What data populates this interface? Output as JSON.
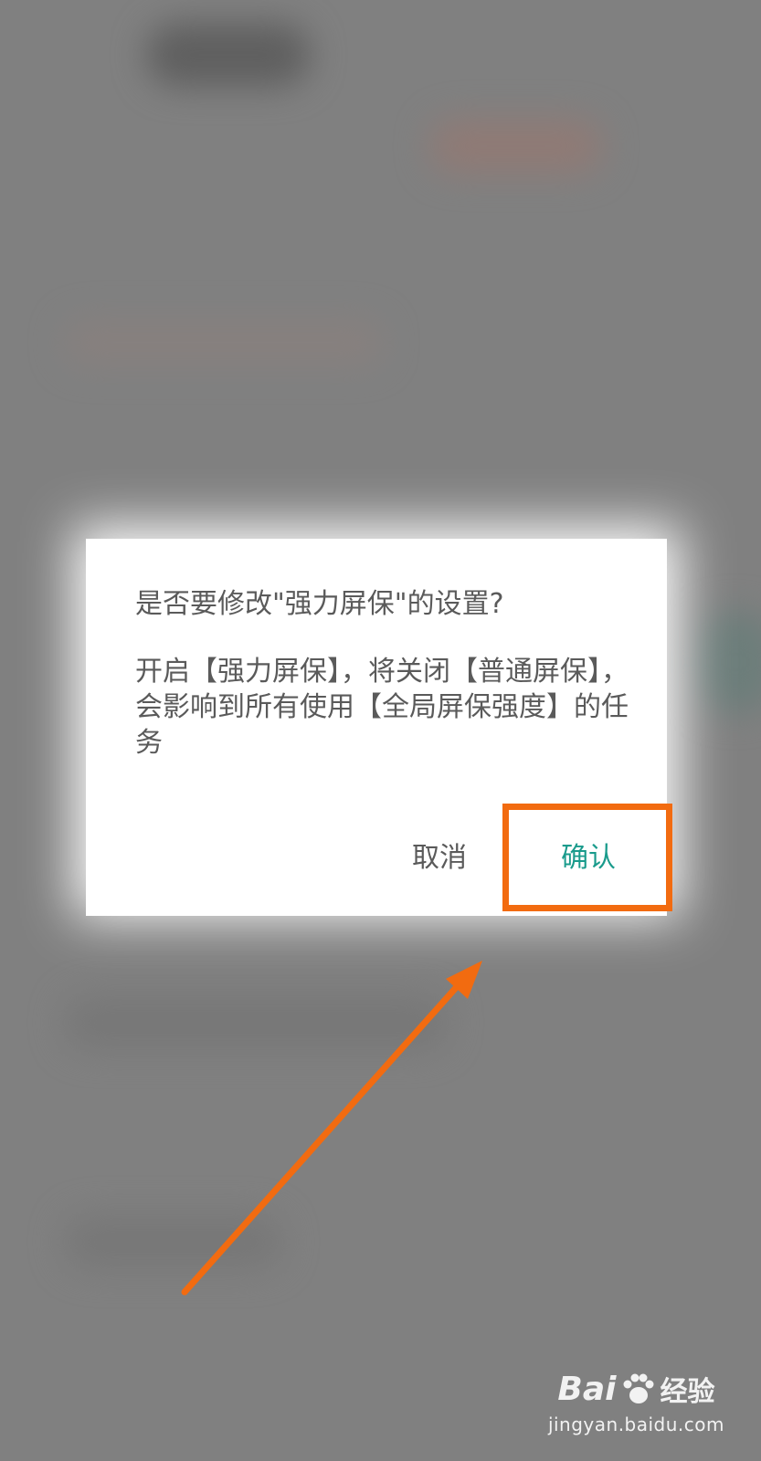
{
  "dialog": {
    "title": "是否要修改\"强力屏保\"的设置?",
    "message": "开启【强力屏保】，将关闭【普通屏保】，会影响到所有使用【全局屏保强度】的任务",
    "cancel_label": "取消",
    "confirm_label": "确认"
  },
  "colors": {
    "overlay": "#808080",
    "confirm_text": "#1a9b8c",
    "annotation": "#f26b10"
  },
  "watermark": {
    "brand_latin": "Bai",
    "brand_cn": "经验",
    "url": "jingyan.baidu.com"
  }
}
